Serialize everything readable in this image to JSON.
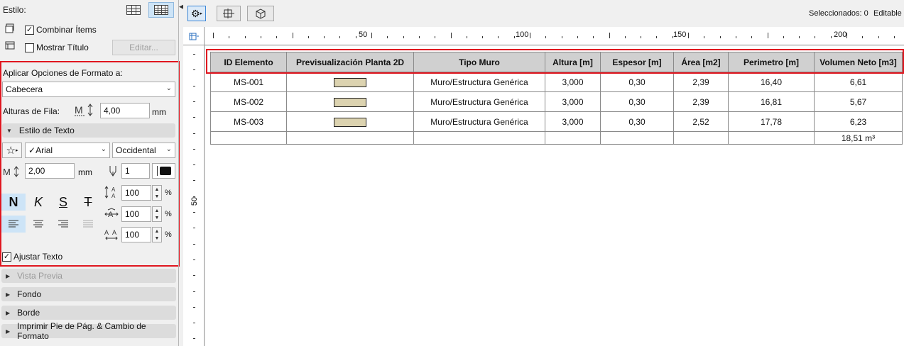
{
  "left_panel": {
    "style_label": "Estilo:",
    "combine_items_label": "Combinar Ítems",
    "combine_items_checked": true,
    "show_title_label": "Mostrar Título",
    "show_title_checked": false,
    "edit_button": "Editar...",
    "apply_format_label": "Aplicar Opciones de Formato a:",
    "apply_format_value": "Cabecera",
    "row_heights_label": "Alturas de Fila:",
    "row_height_value": "4,00",
    "row_height_unit": "mm",
    "text_style_header": "Estilo de Texto",
    "font_value": "Arial",
    "font_check": "✓",
    "script_value": "Occidental",
    "font_size_value": "2,00",
    "font_size_unit": "mm",
    "pen_value": "1",
    "bold_label": "N",
    "italic_label": "K",
    "underline_label": "S",
    "strike_label": "T",
    "spacing_1": "100",
    "spacing_2": "100",
    "spacing_3": "100",
    "percent": "%",
    "wrap_text_label": "Ajustar Texto",
    "wrap_text_checked": true,
    "sections": [
      {
        "label": "Vista Previa",
        "disabled": true
      },
      {
        "label": "Fondo",
        "disabled": false
      },
      {
        "label": "Borde",
        "disabled": false
      },
      {
        "label": "Imprimir Pie de Pág. & Cambio de Formato",
        "disabled": false
      }
    ]
  },
  "toolbar": {
    "selected_label": "Seleccionados: 0",
    "editable_label": "Editable"
  },
  "ruler": {
    "h_labels": [
      "50",
      "100",
      "150",
      "200"
    ],
    "v_labels": [
      "50"
    ]
  },
  "schedule": {
    "headers": [
      "ID Elemento",
      "Previsualización Planta 2D",
      "Tipo Muro",
      "Altura [m]",
      "Espesor [m]",
      "Área [m2]",
      "Perimetro [m]",
      "Volumen Neto [m3]"
    ],
    "rows": [
      [
        "MS-001",
        "",
        "Muro/Estructura Genérica",
        "3,000",
        "0,30",
        "2,39",
        "16,40",
        "6,61"
      ],
      [
        "MS-002",
        "",
        "Muro/Estructura Genérica",
        "3,000",
        "0,30",
        "2,39",
        "16,81",
        "5,67"
      ],
      [
        "MS-003",
        "",
        "Muro/Estructura Genérica",
        "3,000",
        "0,30",
        "2,52",
        "17,78",
        "6,23"
      ]
    ],
    "total": [
      "",
      "",
      "",
      "",
      "",
      "",
      "",
      "18,51 m³"
    ]
  },
  "colors": {
    "highlight_red": "#e0161f",
    "header_gray": "#d0d0d0",
    "swatch_fill": "#dcd3b0",
    "active_blue": "#cde4f7"
  }
}
